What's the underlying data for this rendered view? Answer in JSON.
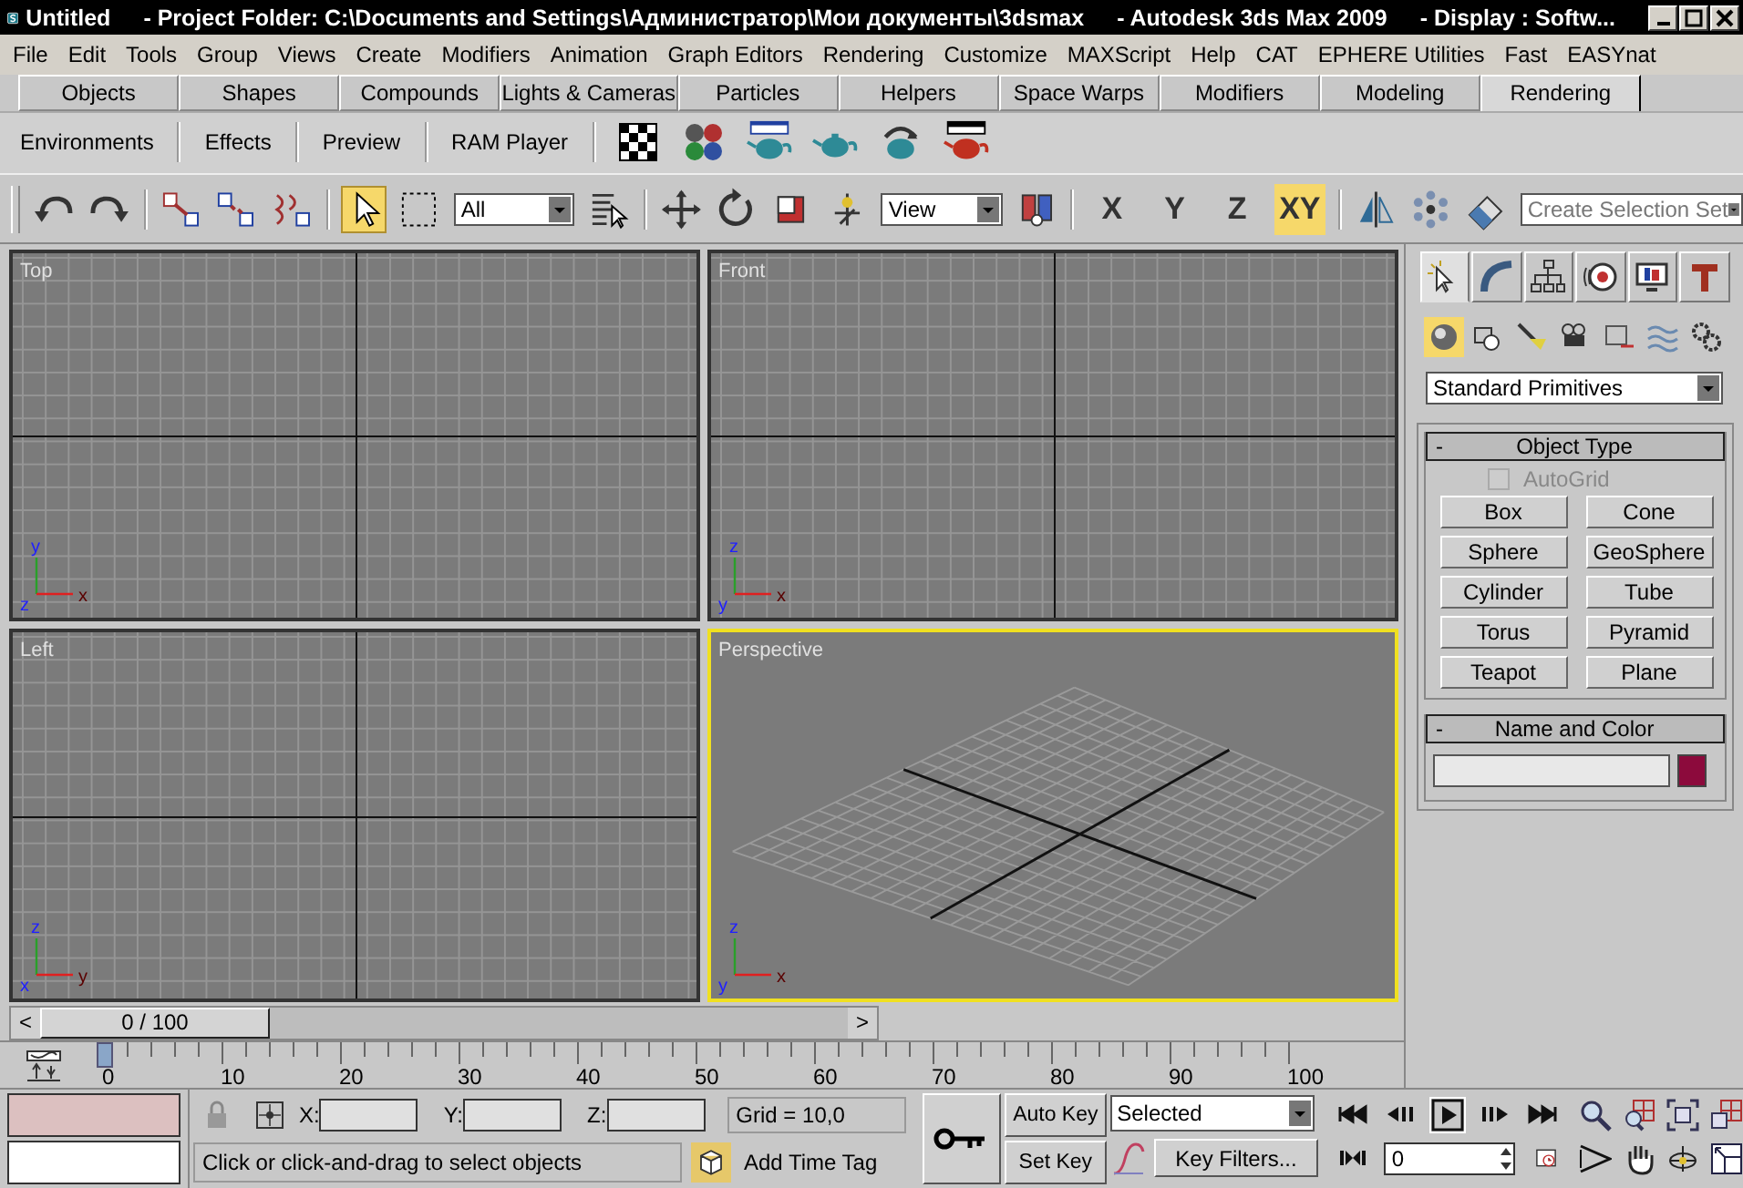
{
  "window": {
    "title_parts": [
      "Untitled",
      "- Project Folder: C:\\Documents and Settings\\Администратор\\Мои документы\\3dsmax",
      "- Autodesk 3ds Max  2009",
      "- Display : Softw..."
    ]
  },
  "menu": [
    "File",
    "Edit",
    "Tools",
    "Group",
    "Views",
    "Create",
    "Modifiers",
    "Animation",
    "Graph Editors",
    "Rendering",
    "Customize",
    "MAXScript",
    "Help",
    "CAT",
    "EPHERE Utilities",
    "Fast",
    "EASYnat"
  ],
  "tabs": [
    {
      "label": "Objects",
      "selected": false
    },
    {
      "label": "Shapes",
      "selected": false
    },
    {
      "label": "Compounds",
      "selected": false
    },
    {
      "label": "Lights & Cameras",
      "selected": false
    },
    {
      "label": "Particles",
      "selected": false
    },
    {
      "label": "Helpers",
      "selected": false
    },
    {
      "label": "Space Warps",
      "selected": false
    },
    {
      "label": "Modifiers",
      "selected": false
    },
    {
      "label": "Modeling",
      "selected": false
    },
    {
      "label": "Rendering",
      "selected": true
    }
  ],
  "ribbon_buttons": [
    "Environments",
    "Effects",
    "Preview",
    "RAM Player"
  ],
  "toolbar": {
    "select_tool_selected": true,
    "selection_filter": "All",
    "reference_coordinate": "View",
    "axis_buttons": [
      {
        "label": "X",
        "selected": false
      },
      {
        "label": "Y",
        "selected": false
      },
      {
        "label": "Z",
        "selected": false
      },
      {
        "label": "XY",
        "selected": true
      }
    ],
    "named_selection": {
      "placeholder": "Create Selection Set"
    }
  },
  "viewports": [
    {
      "label": "Top",
      "kind": "ortho",
      "active": false,
      "axes": {
        "up": "y",
        "right": "x",
        "origin": "z"
      }
    },
    {
      "label": "Front",
      "kind": "ortho",
      "active": false,
      "axes": {
        "up": "z",
        "right": "x",
        "origin": "y"
      }
    },
    {
      "label": "Left",
      "kind": "ortho",
      "active": false,
      "axes": {
        "up": "z",
        "right": "y",
        "origin": "x"
      }
    },
    {
      "label": "Perspective",
      "kind": "perspective",
      "active": true,
      "axes": {
        "up": "z",
        "right": "x",
        "origin": "y"
      }
    }
  ],
  "command_panel": {
    "tabs": [
      {
        "selected": true
      },
      {
        "selected": false
      },
      {
        "selected": false
      },
      {
        "selected": false
      },
      {
        "selected": false
      },
      {
        "selected": false
      }
    ],
    "categories": [
      {
        "selected": true
      },
      {
        "selected": false
      },
      {
        "selected": false
      },
      {
        "selected": false
      },
      {
        "selected": false
      },
      {
        "selected": false
      },
      {
        "selected": false
      }
    ],
    "dropdown": "Standard Primitives",
    "object_type": {
      "title": "Object Type",
      "collapse": "-",
      "autogrid": {
        "label": "AutoGrid",
        "checked": false,
        "disabled": true
      },
      "buttons": [
        "Box",
        "Cone",
        "Sphere",
        "GeoSphere",
        "Cylinder",
        "Tube",
        "Torus",
        "Pyramid",
        "Teapot",
        "Plane"
      ]
    },
    "name_and_color": {
      "title": "Name and Color",
      "collapse": "-",
      "color": "#8c0a3c"
    }
  },
  "time_slider": {
    "label": "0 / 100",
    "level": 0,
    "prev": "<",
    "next": ">"
  },
  "track_bar": {
    "labels": [
      "0",
      "10",
      "20",
      "30",
      "40",
      "50",
      "60",
      "70",
      "80",
      "90",
      "100"
    ]
  },
  "status_bar": {
    "x_label": "X:",
    "y_label": "Y:",
    "z_label": "Z:",
    "grid": "Grid = 10,0",
    "prompt": "Click or click-and-drag to select objects",
    "time_tag": "Add Time Tag",
    "auto_key": "Auto Key",
    "set_key": "Set Key",
    "key_mode": "Selected",
    "key_filters": "Key Filters...",
    "frame": "0",
    "play_selected": true
  }
}
